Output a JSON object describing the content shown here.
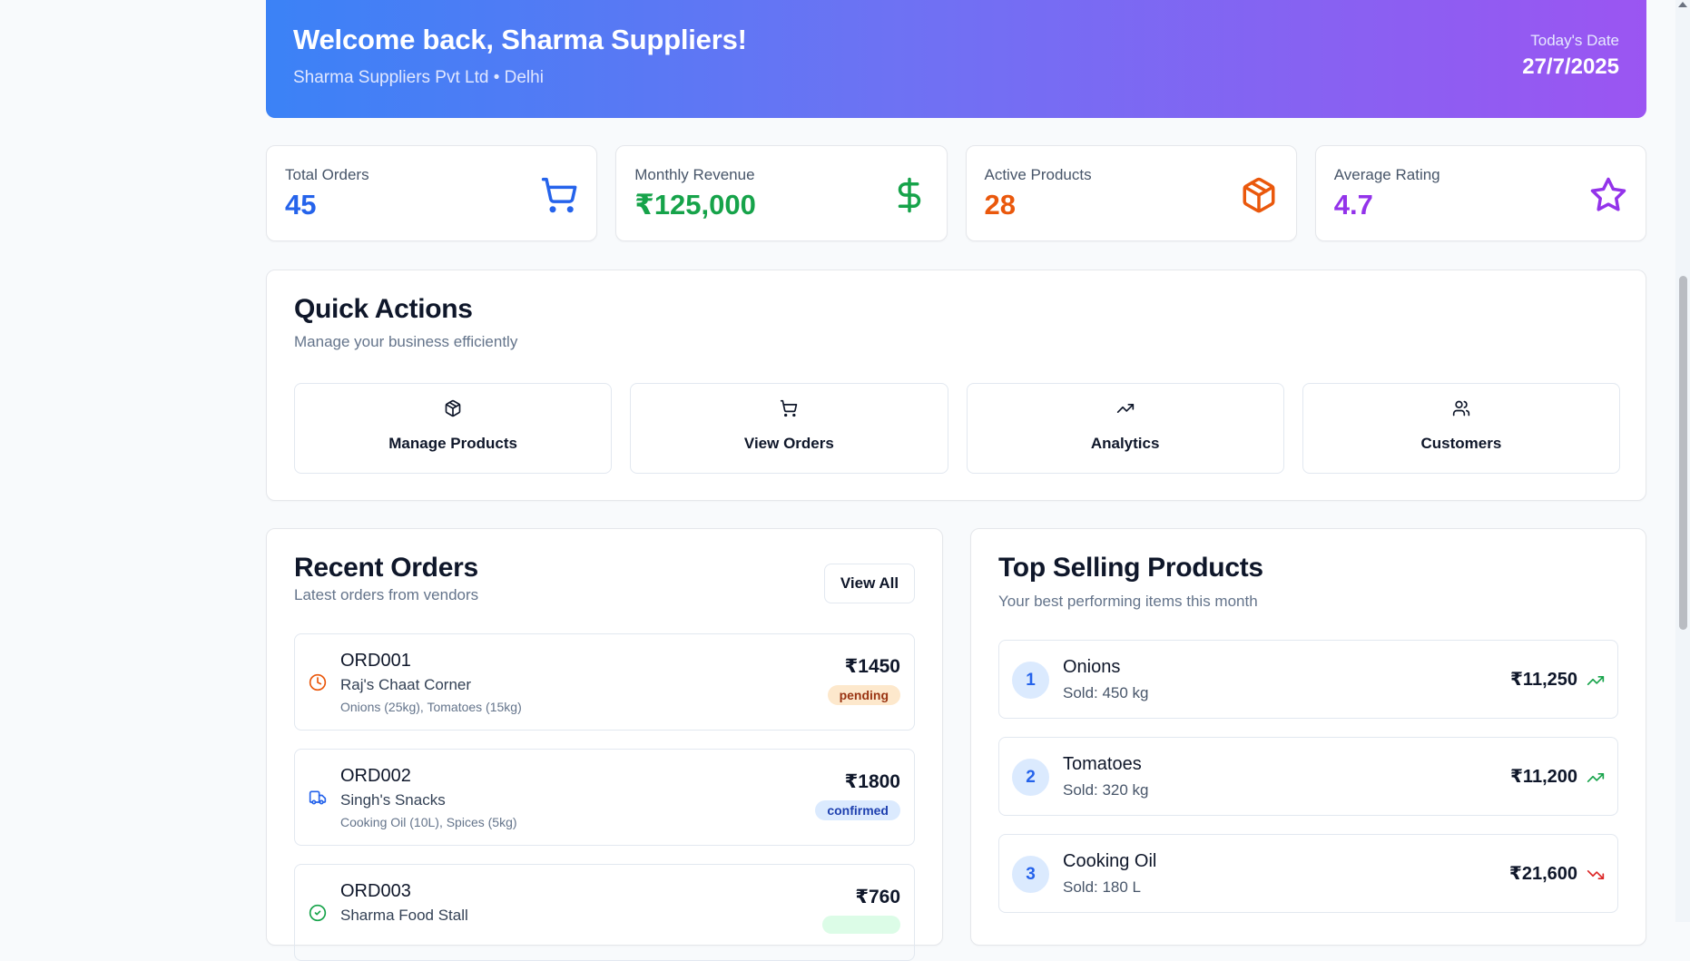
{
  "header": {
    "welcome": "Welcome back, Sharma Suppliers!",
    "subtitle": "Sharma Suppliers Pvt Ltd • Delhi",
    "date_label": "Today's Date",
    "date_value": "27/7/2025"
  },
  "stats": [
    {
      "label": "Total Orders",
      "value": "45",
      "icon": "cart-icon",
      "color": "#2563eb"
    },
    {
      "label": "Monthly Revenue",
      "value": "₹125,000",
      "icon": "dollar-icon",
      "color": "#16a34a"
    },
    {
      "label": "Active Products",
      "value": "28",
      "icon": "package-icon",
      "color": "#ea580c"
    },
    {
      "label": "Average Rating",
      "value": "4.7",
      "icon": "star-icon",
      "color": "#9333ea"
    }
  ],
  "quick_actions": {
    "title": "Quick Actions",
    "subtitle": "Manage your business efficiently",
    "items": [
      {
        "label": "Manage Products",
        "icon": "package-icon"
      },
      {
        "label": "View Orders",
        "icon": "cart-icon"
      },
      {
        "label": "Analytics",
        "icon": "trending-up-icon"
      },
      {
        "label": "Customers",
        "icon": "users-icon"
      }
    ]
  },
  "recent_orders": {
    "title": "Recent Orders",
    "subtitle": "Latest orders from vendors",
    "view_all": "View All",
    "orders": [
      {
        "id": "ORD001",
        "vendor": "Raj's Chaat Corner",
        "items": "Onions (25kg), Tomatoes (15kg)",
        "amount": "₹1450",
        "status": "pending",
        "icon": "clock-icon"
      },
      {
        "id": "ORD002",
        "vendor": "Singh's Snacks",
        "items": "Cooking Oil (10L), Spices (5kg)",
        "amount": "₹1800",
        "status": "confirmed",
        "icon": "truck-icon"
      },
      {
        "id": "ORD003",
        "vendor": "Sharma Food Stall",
        "items": "",
        "amount": "₹760",
        "status": "",
        "icon": "check-circle-icon"
      }
    ]
  },
  "top_products": {
    "title": "Top Selling Products",
    "subtitle": "Your best performing items this month",
    "products": [
      {
        "rank": "1",
        "name": "Onions",
        "sold": "Sold: 450 kg",
        "revenue": "₹11,250",
        "trend": "up"
      },
      {
        "rank": "2",
        "name": "Tomatoes",
        "sold": "Sold: 320 kg",
        "revenue": "₹11,200",
        "trend": "up"
      },
      {
        "rank": "3",
        "name": "Cooking Oil",
        "sold": "Sold: 180 L",
        "revenue": "₹21,600",
        "trend": "down"
      }
    ]
  },
  "colors": {
    "gradient_start": "#3b82f6",
    "gradient_end": "#a855f7",
    "trend_up": "#16a34a",
    "trend_down": "#dc2626"
  }
}
